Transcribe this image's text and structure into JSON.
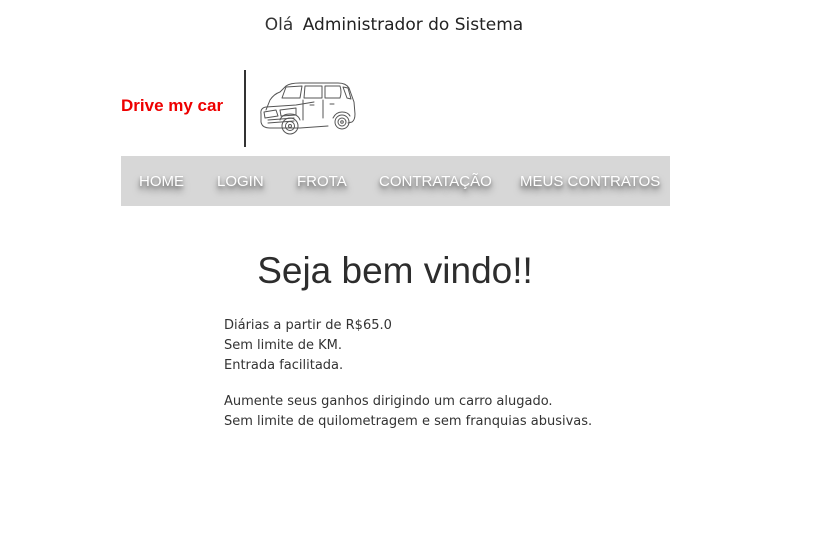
{
  "header": {
    "greeting": "Olá",
    "user_name": "Administrador do Sistema"
  },
  "brand": {
    "name": "Drive my car",
    "color": "#ee0000",
    "logo_icon": "car-icon"
  },
  "nav": {
    "background": "#d7d7d7",
    "items": [
      {
        "label": "HOME"
      },
      {
        "label": "LOGIN"
      },
      {
        "label": "FROTA"
      },
      {
        "label": "CONTRATAÇÃO"
      },
      {
        "label": "MEUS CONTRATOS"
      }
    ]
  },
  "main": {
    "title": "Seja bem vindo!!",
    "lines": [
      "Diárias a partir de R$65.0",
      "Sem limite de KM.",
      "Entrada facilitada."
    ],
    "paragraph2": [
      "Aumente seus ganhos dirigindo um carro alugado.",
      "Sem limite de quilometragem e sem franquias abusivas."
    ]
  }
}
